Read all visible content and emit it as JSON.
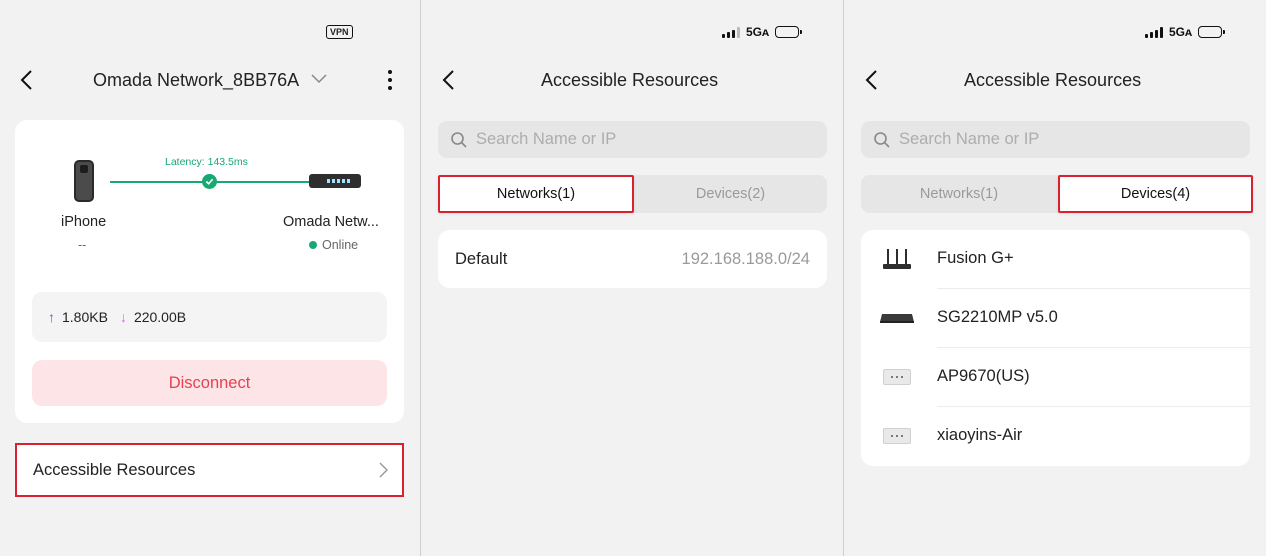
{
  "panel1": {
    "status": {
      "vpn": "VPN"
    },
    "header": {
      "title": "Omada Network_8BB76A"
    },
    "connection": {
      "latency": "Latency: 143.5ms",
      "client_name": "iPhone",
      "client_sub": "--",
      "gateway_name": "Omada Netw...",
      "gateway_status": "Online",
      "upload": "1.80KB",
      "download": "220.00B",
      "disconnect_label": "Disconnect"
    },
    "resources_row": {
      "label": "Accessible Resources"
    }
  },
  "panel2": {
    "status": {
      "network": "5Gᴀ"
    },
    "header": {
      "title": "Accessible Resources"
    },
    "search": {
      "placeholder": "Search Name or IP"
    },
    "tabs": [
      {
        "label": "Networks(1)"
      },
      {
        "label": "Devices(2)"
      }
    ],
    "networks": [
      {
        "name": "Default",
        "subnet": "192.168.188.0/24"
      }
    ]
  },
  "panel3": {
    "status": {
      "network": "5Gᴀ"
    },
    "header": {
      "title": "Accessible Resources"
    },
    "search": {
      "placeholder": "Search Name or IP"
    },
    "tabs": [
      {
        "label": "Networks(1)"
      },
      {
        "label": "Devices(4)"
      }
    ],
    "devices": [
      {
        "name": "Fusion G+",
        "icon": "router-icon"
      },
      {
        "name": "SG2210MP v5.0",
        "icon": "switch-icon"
      },
      {
        "name": "AP9670(US)",
        "icon": "access-point-icon"
      },
      {
        "name": "xiaoyins-Air",
        "icon": "access-point-icon"
      }
    ]
  },
  "colors": {
    "accent_green": "#19a874",
    "highlight_red": "#d8222f",
    "disconnect_bg": "#fde5e7",
    "disconnect_text": "#e6414f",
    "upload_arrow": "#2f6fe8",
    "download_arrow": "#d06de6"
  }
}
